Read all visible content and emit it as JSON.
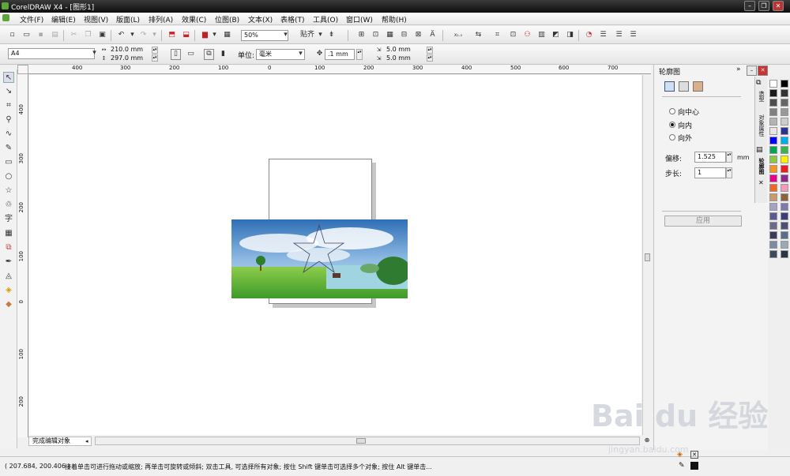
{
  "window": {
    "title": "CorelDRAW X4 - [图形1]"
  },
  "menu": [
    "文件(F)",
    "编辑(E)",
    "视图(V)",
    "版面(L)",
    "排列(A)",
    "效果(C)",
    "位图(B)",
    "文本(X)",
    "表格(T)",
    "工具(O)",
    "窗口(W)",
    "帮助(H)"
  ],
  "toolbar": {
    "zoom": "50%",
    "snap_label": "贴齐"
  },
  "property_bar": {
    "page_size": "A4",
    "width": "210.0 mm",
    "height": "297.0 mm",
    "unit_label": "单位:",
    "unit": "毫米",
    "nudge": ".1 mm",
    "dup_x": "5.0 mm",
    "dup_y": "5.0 mm"
  },
  "ruler_h": [
    "400",
    "300",
    "200",
    "100",
    "0",
    "100",
    "200",
    "300",
    "400",
    "500",
    "600",
    "700"
  ],
  "ruler_v": [
    "400",
    "300",
    "200",
    "100",
    "0",
    "100",
    "200"
  ],
  "page_tab": "完成编辑对象",
  "status": {
    "coords": "( 207.684, 200.406 )",
    "hint": "接着单击可进行拖动或缩放; 再单击可旋转或倾斜; 双击工具, 可选择所有对象; 按住 Shift 键单击可选择多个对象; 按住 Alt 键单击..."
  },
  "docker": {
    "title": "轮廓图",
    "options": [
      "向中心",
      "向内",
      "向外"
    ],
    "selected_option": "向内",
    "offset_label": "偏移:",
    "offset": "1.525",
    "offset_unit": "mm",
    "steps_label": "步长:",
    "steps": "1",
    "apply": "应用",
    "side_tabs": [
      "造型",
      "对象属性",
      "轮廓图"
    ]
  },
  "palette_colors": [
    "#ffffff",
    "#000000",
    "#1a1a1a",
    "#333333",
    "#4d4d4d",
    "#666666",
    "#808080",
    "#999999",
    "#b3b3b3",
    "#cccccc",
    "#e6e6e6",
    "#2e3192",
    "#0000ff",
    "#00aeef",
    "#00a651",
    "#39b54a",
    "#8dc63f",
    "#fff200",
    "#f7941d",
    "#ed1c24",
    "#ec008c",
    "#92278f",
    "#f26522",
    "#f49ac1",
    "#c69c6d",
    "#8c6239",
    "#a3a3c8",
    "#7b7bb0",
    "#5a5a96",
    "#3d3d7a",
    "#6b6b8c",
    "#4f4f73",
    "#3a3a5c",
    "#586e8c",
    "#7a8ca3",
    "#9aa8ba",
    "#3c4a5e",
    "#2a3444"
  ],
  "watermark": {
    "brand": "Bai du 经验",
    "url": "jingyan.baidu.com"
  }
}
